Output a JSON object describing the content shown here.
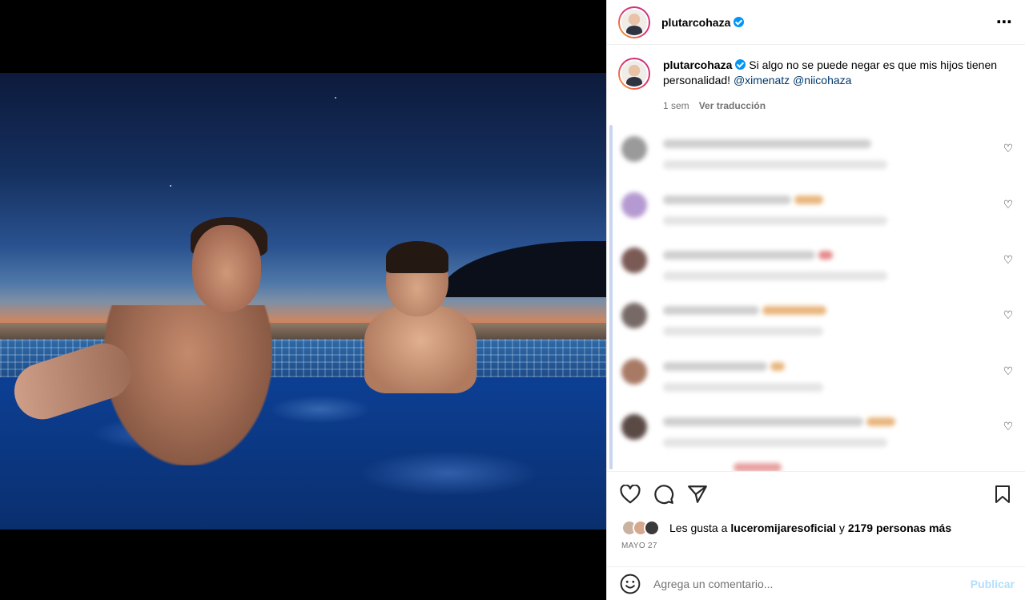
{
  "post": {
    "username": "plutarcohaza",
    "caption_text": "Si algo no se puede negar es que mis hijos tienen personalidad!",
    "mention_1": "@ximenatz",
    "mention_2": "@niicohaza",
    "time_ago": "1 sem",
    "translate_label": "Ver traducción",
    "more_icon": "⋯"
  },
  "comments": [
    {
      "avatar_color": "#9a9a9a",
      "heart": "♡"
    },
    {
      "avatar_color": "#b59ad1",
      "heart": "♡"
    },
    {
      "avatar_color": "#7a5a55",
      "heart": "♡"
    },
    {
      "avatar_color": "#776a66",
      "heart": "♡"
    },
    {
      "avatar_color": "#a87a65",
      "heart": "♡"
    },
    {
      "avatar_color": "#5a4a45",
      "heart": "♡"
    }
  ],
  "likes": {
    "prefix": "Les gusta a",
    "user": "luceromijaresoficial",
    "connector": "y",
    "others": "2179 personas más"
  },
  "date": "MAYO 27",
  "add_comment": {
    "placeholder": "Agrega un comentario...",
    "publish_label": "Publicar"
  },
  "colors": {
    "link": "#00376b",
    "verified": "#0095f6",
    "publish_disabled": "#b2dffc"
  }
}
